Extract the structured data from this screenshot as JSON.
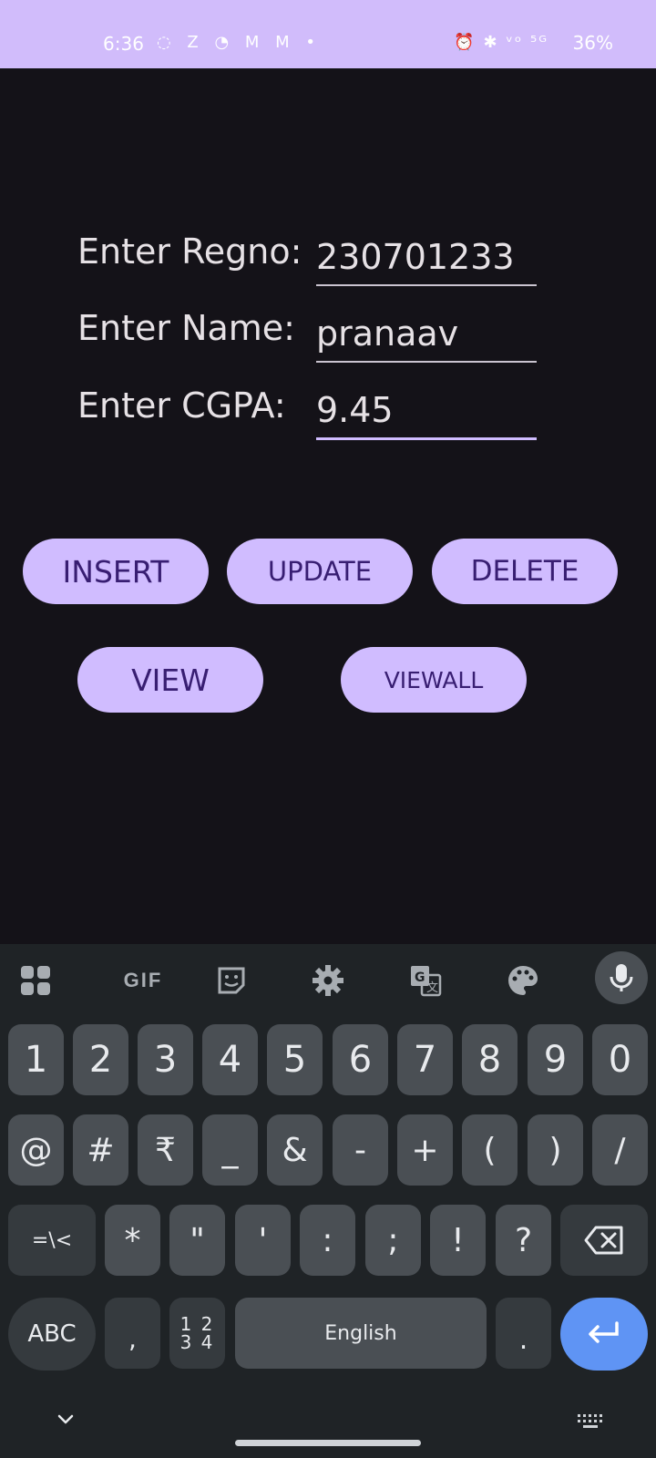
{
  "status_bar": {
    "time": "6:36",
    "notification_icons": "◌ Z ◔ M M •",
    "right_icons": "⏰ ✱ ᵛᵒ ⁵ᴳ",
    "battery": "36%"
  },
  "form": {
    "regno_label": "Enter Regno:",
    "regno_value": "230701233",
    "name_label": "Enter Name:",
    "name_value": "pranaav",
    "cgpa_label": "Enter CGPA:",
    "cgpa_value": "9.45"
  },
  "buttons": {
    "insert": "INSERT",
    "update": "UPDATE",
    "delete": "DELETE",
    "view": "VIEW",
    "viewall": "VIEWALL"
  },
  "keyboard": {
    "toolbar": {
      "gif": "GIF"
    },
    "row1": [
      "1",
      "2",
      "3",
      "4",
      "5",
      "6",
      "7",
      "8",
      "9",
      "0"
    ],
    "row2": [
      "@",
      "#",
      "₹",
      "_",
      "&",
      "-",
      "+",
      "(",
      ")",
      "/"
    ],
    "row3": [
      "=\\<",
      "*",
      "\"",
      "'",
      ":",
      ";",
      "!",
      "?"
    ],
    "abc": "ABC",
    "comma": ",",
    "numpad_top": "1 2",
    "numpad_bottom": "3 4",
    "space": "English",
    "period": "."
  },
  "colors": {
    "status_bar": "#d1bcfb",
    "background": "#141218",
    "button": "#d0bcff",
    "button_text": "#381e72",
    "keyboard_bg": "#1f2326",
    "key": "#4a4f54",
    "enter_key": "#5f94f4"
  }
}
